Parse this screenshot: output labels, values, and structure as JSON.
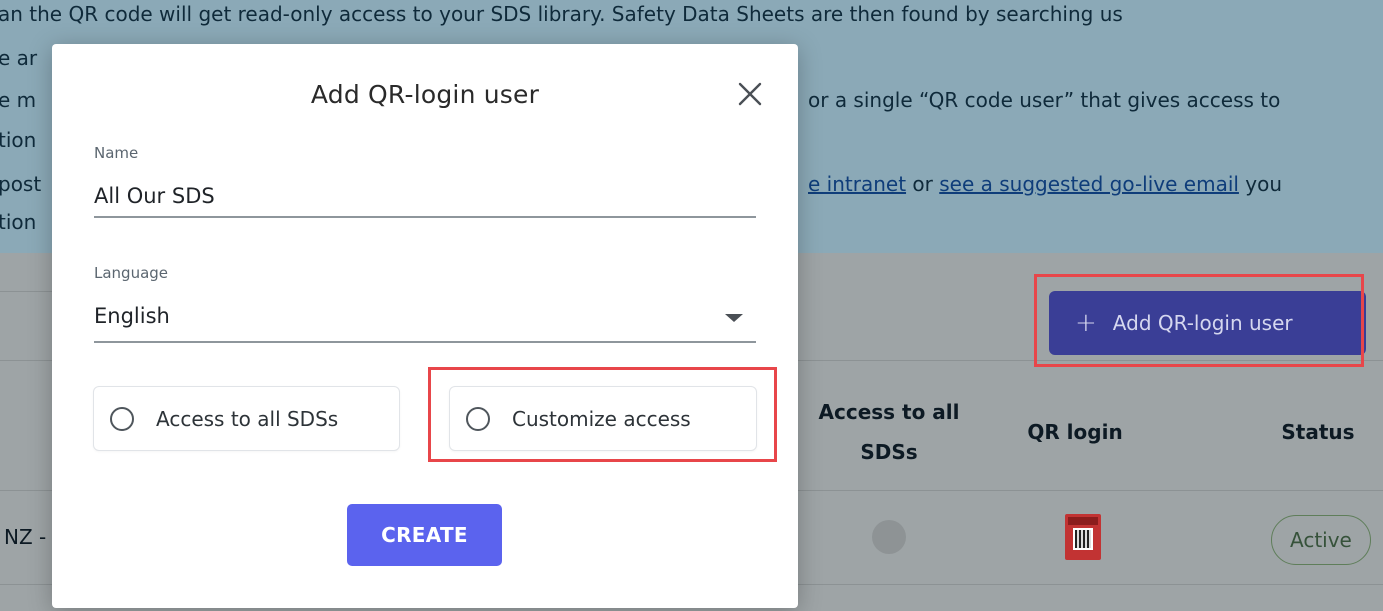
{
  "background": {
    "info_lines": [
      "an the QR code will get read-only access to your SDS library. Safety Data Sheets are then found by searching us",
      "e ar",
      "e m",
      "tion",
      "post",
      "tion"
    ],
    "line3_right": "or a single “QR code user” that gives access to",
    "line5_link1": "e intranet",
    "line5_mid": " or ",
    "line5_link2": "see a suggested go-live email",
    "line5_tail": " you",
    "add_button_label": "Add QR-login user",
    "table_headers": {
      "access_all_line1": "Access to all",
      "access_all_line2": "SDSs",
      "qr_login": "QR login",
      "status": "Status"
    },
    "row": {
      "name_fragment": "NZ -",
      "status": "Active"
    }
  },
  "modal": {
    "title": "Add QR-login user",
    "name_label": "Name",
    "name_value": "All Our SDS",
    "language_label": "Language",
    "language_value": "English",
    "option_all": "Access to all SDSs",
    "option_custom": "Customize access",
    "create_label": "CREATE"
  },
  "colors": {
    "accent": "#5b63ee",
    "add_button": "#3a3e96",
    "highlight": "#e8464a"
  }
}
